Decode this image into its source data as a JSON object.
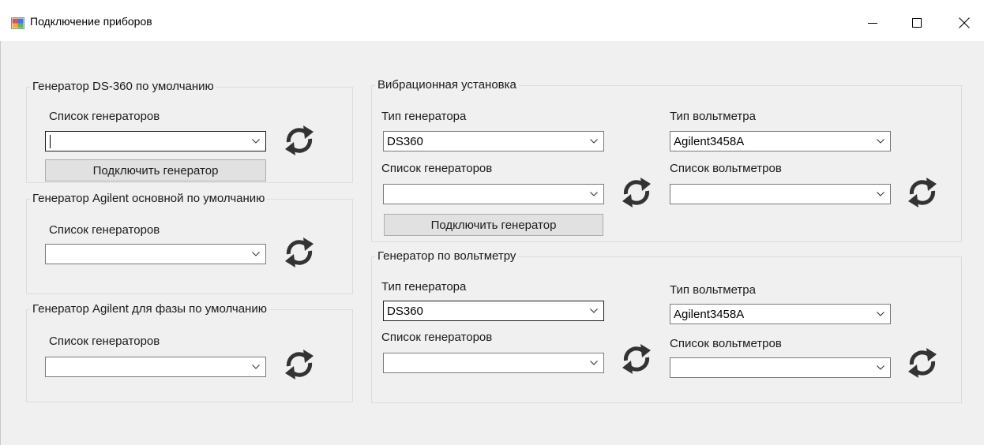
{
  "window": {
    "title": "Подключение приборов",
    "controls": [
      "minimize-icon",
      "maximize-icon",
      "close-icon"
    ]
  },
  "groups": {
    "ds360_default": {
      "legend": "Генератор DS-360 по умолчанию",
      "list_label": "Список генераторов",
      "list_value": "",
      "connect_button": "Подключить генератор"
    },
    "agilent_main_default": {
      "legend": "Генератор Agilent основной по умолчанию",
      "list_label": "Список генераторов",
      "list_value": ""
    },
    "agilent_phase_default": {
      "legend": "Генератор Agilent для фазы по умолчанию",
      "list_label": "Список генераторов",
      "list_value": ""
    },
    "vibration": {
      "legend": "Вибрационная установка",
      "gen_type_label": "Тип генератора",
      "gen_type_value": "DS360",
      "voltmeter_type_label": "Тип вольтметра",
      "voltmeter_type_value": "Agilent3458A",
      "gen_list_label": "Список генераторов",
      "gen_list_value": "",
      "voltmeter_list_label": "Список вольтметров",
      "voltmeter_list_value": "",
      "connect_button": "Подключить генератор"
    },
    "by_voltmeter": {
      "legend": "Генератор по вольтметру",
      "gen_type_label": "Тип генератора",
      "gen_type_value": "DS360",
      "voltmeter_type_label": "Тип вольтметра",
      "voltmeter_type_value": "Agilent3458A",
      "gen_list_label": "Список генераторов",
      "gen_list_value": "",
      "voltmeter_list_label": "Список вольтметров",
      "voltmeter_list_value": ""
    }
  },
  "icons": {
    "refresh": "refresh-icon",
    "dropdown": "chevron-down-icon",
    "app": "app-icon"
  },
  "colors": {
    "window_bg": "#f0f0f0",
    "titlebar_bg": "#ffffff",
    "button_bg": "#e1e1e1",
    "icon_color": "#333333"
  }
}
